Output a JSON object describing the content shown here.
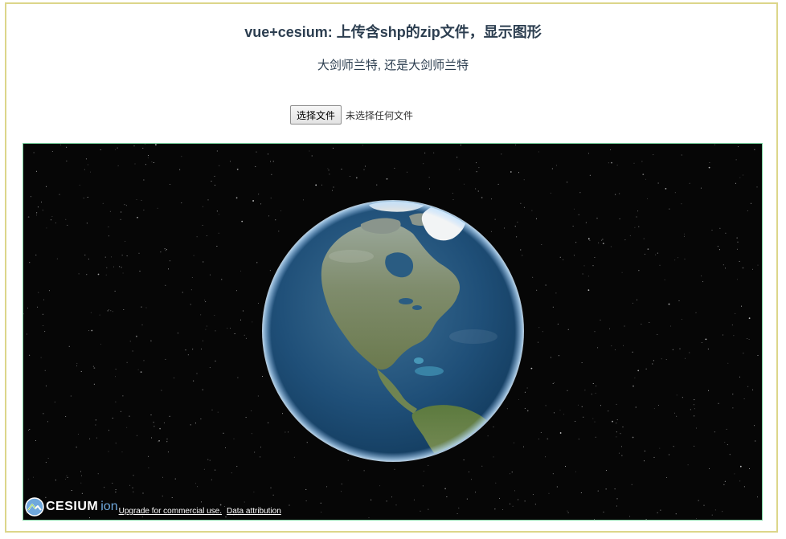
{
  "page": {
    "title": "vue+cesium: 上传含shp的zip文件，显示图形",
    "subtitle": "大剑师兰特, 还是大剑师兰特"
  },
  "file_input": {
    "button_label": "选择文件",
    "status_text": "未选择任何文件"
  },
  "viewer": {
    "logo_text": "CESIUM",
    "logo_suffix": "ion",
    "upgrade_link": "Upgrade for commercial use.",
    "attribution_link": "Data attribution",
    "background_color": "#060606",
    "globe_icon": "globe-earth"
  },
  "colors": {
    "frame_border": "#dcd68a",
    "viewer_border": "#7bd3a0",
    "heading_text": "#2c3e50"
  }
}
